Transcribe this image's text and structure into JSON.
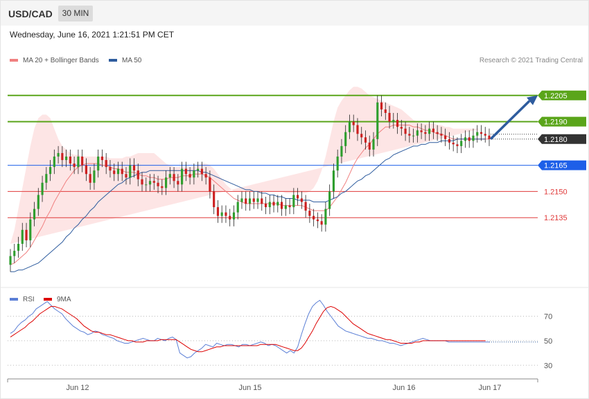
{
  "header": {
    "symbol": "USD/CAD",
    "timeframe": "30 MIN"
  },
  "timestamp": "Wednesday, June 16, 2021 1:21:51 PM CET",
  "copyright": "Research © 2021 Trading Central",
  "legend": {
    "price": [
      {
        "label": "MA 20 + Bollinger Bands",
        "color": "#f08080"
      },
      {
        "label": "MA 50",
        "color": "#2e5c9e"
      }
    ],
    "rsi": [
      {
        "label": "RSI",
        "color": "#5b7fd6"
      },
      {
        "label": "9MA",
        "color": "#dd0000"
      }
    ]
  },
  "colors": {
    "bullish": "#2e9e2e",
    "bearish": "#cc1f1f",
    "resistance": "#5aa51a",
    "support_strong": "#1d5fe8",
    "support": "#e03a3a",
    "arrow": "#2e5c9e",
    "band_fill": "#fde2e2"
  },
  "chart_data": [
    {
      "type": "line",
      "name": "price",
      "x_labels": [
        "Jun 12",
        "Jun 15",
        "Jun 16",
        "Jun 17"
      ],
      "ylim": [
        1.2095,
        1.222
      ],
      "last_price": "1.2180",
      "levels": [
        {
          "value": 1.2205,
          "label": "1.2205",
          "kind": "resistance"
        },
        {
          "value": 1.219,
          "label": "1.2190",
          "kind": "resistance"
        },
        {
          "value": 1.218,
          "label": "1.2180",
          "kind": "last"
        },
        {
          "value": 1.2165,
          "label": "1.2165",
          "kind": "support_strong"
        },
        {
          "value": 1.215,
          "label": "1.2150",
          "kind": "support"
        },
        {
          "value": 1.2135,
          "label": "1.2135",
          "kind": "support"
        }
      ],
      "close": [
        1.2113,
        1.2116,
        1.212,
        1.2128,
        1.2122,
        1.2134,
        1.214,
        1.2148,
        1.2155,
        1.216,
        1.2164,
        1.217,
        1.2172,
        1.2168,
        1.217,
        1.2166,
        1.2164,
        1.217,
        1.2165,
        1.216,
        1.2155,
        1.2162,
        1.217,
        1.2168,
        1.2164,
        1.2162,
        1.216,
        1.2163,
        1.216,
        1.2158,
        1.2165,
        1.2162,
        1.2157,
        1.2154,
        1.2154,
        1.2156,
        1.2155,
        1.2153,
        1.2152,
        1.2158,
        1.216,
        1.2156,
        1.2154,
        1.2163,
        1.216,
        1.2158,
        1.2162,
        1.2163,
        1.216,
        1.2158,
        1.215,
        1.2141,
        1.2136,
        1.2138,
        1.2136,
        1.2134,
        1.2138,
        1.2144,
        1.2146,
        1.2143,
        1.2146,
        1.2144,
        1.2146,
        1.2143,
        1.2141,
        1.2144,
        1.2142,
        1.2144,
        1.214,
        1.2142,
        1.2141,
        1.2148,
        1.2146,
        1.2144,
        1.2139,
        1.2136,
        1.2134,
        1.2133,
        1.2131,
        1.214,
        1.215,
        1.2162,
        1.217,
        1.2176,
        1.2184,
        1.219,
        1.2188,
        1.2183,
        1.2181,
        1.2178,
        1.2174,
        1.218,
        1.2201,
        1.2197,
        1.2195,
        1.219,
        1.2191,
        1.2187,
        1.2186,
        1.2183,
        1.2182,
        1.2182,
        1.2185,
        1.2184,
        1.2183,
        1.2186,
        1.2184,
        1.2183,
        1.2182,
        1.218,
        1.2178,
        1.2177,
        1.2176,
        1.2179,
        1.2181,
        1.2179,
        1.2182,
        1.2184,
        1.2183,
        1.2182,
        1.218
      ],
      "ma20": [
        1.2108,
        1.2109,
        1.2111,
        1.2113,
        1.2115,
        1.2118,
        1.2122,
        1.2126,
        1.213,
        1.2135,
        1.2139,
        1.2144,
        1.2148,
        1.2152,
        1.2156,
        1.2159,
        1.2162,
        1.2164,
        1.2165,
        1.2166,
        1.2166,
        1.2166,
        1.2166,
        1.2165,
        1.2165,
        1.2164,
        1.2163,
        1.2163,
        1.2162,
        1.2161,
        1.2161,
        1.2161,
        1.216,
        1.2159,
        1.2159,
        1.2158,
        1.2158,
        1.2157,
        1.2157,
        1.2157,
        1.2158,
        1.2158,
        1.2158,
        1.2159,
        1.2159,
        1.2159,
        1.216,
        1.216,
        1.216,
        1.2159,
        1.2158,
        1.2156,
        1.2154,
        1.2152,
        1.215,
        1.2148,
        1.2146,
        1.2145,
        1.2144,
        1.2143,
        1.2143,
        1.2143,
        1.2143,
        1.2143,
        1.2143,
        1.2143,
        1.2143,
        1.2143,
        1.2142,
        1.2142,
        1.2142,
        1.2142,
        1.2142,
        1.2142,
        1.2141,
        1.214,
        1.2139,
        1.2139,
        1.2139,
        1.2139,
        1.2141,
        1.2144,
        1.2147,
        1.2151,
        1.2155,
        1.216,
        1.2165,
        1.2169,
        1.2172,
        1.2175,
        1.2177,
        1.218,
        1.2183,
        1.2185,
        1.2187,
        1.2187,
        1.2188,
        1.2188,
        1.2188,
        1.2188,
        1.2188,
        1.2187,
        1.2187,
        1.2186,
        1.2185,
        1.2185,
        1.2184,
        1.2183,
        1.2183,
        1.2182,
        1.2181,
        1.218,
        1.218,
        1.218,
        1.218,
        1.218,
        1.218,
        1.218,
        1.218,
        1.218,
        1.218
      ],
      "ma50": [
        1.2104,
        1.2104,
        1.2105,
        1.2105,
        1.2106,
        1.2107,
        1.2108,
        1.2109,
        1.2111,
        1.2113,
        1.2115,
        1.2117,
        1.2119,
        1.2121,
        1.2124,
        1.2126,
        1.2129,
        1.2131,
        1.2134,
        1.2136,
        1.2139,
        1.2141,
        1.2144,
        1.2146,
        1.2148,
        1.215,
        1.2152,
        1.2154,
        1.2155,
        1.2157,
        1.2158,
        1.2159,
        1.216,
        1.2161,
        1.2161,
        1.2162,
        1.2162,
        1.2162,
        1.2162,
        1.2162,
        1.2162,
        1.2162,
        1.2162,
        1.2162,
        1.2162,
        1.2162,
        1.2162,
        1.2162,
        1.2161,
        1.2161,
        1.216,
        1.2159,
        1.2158,
        1.2157,
        1.2156,
        1.2155,
        1.2154,
        1.2153,
        1.2152,
        1.2151,
        1.2151,
        1.215,
        1.215,
        1.2149,
        1.2149,
        1.2148,
        1.2148,
        1.2147,
        1.2147,
        1.2146,
        1.2146,
        1.2146,
        1.2145,
        1.2145,
        1.2145,
        1.2145,
        1.2144,
        1.2144,
        1.2144,
        1.2144,
        1.2145,
        1.2146,
        1.2147,
        1.2149,
        1.215,
        1.2152,
        1.2154,
        1.2156,
        1.2157,
        1.2159,
        1.216,
        1.2162,
        1.2164,
        1.2166,
        1.2168,
        1.2169,
        1.2171,
        1.2172,
        1.2173,
        1.2174,
        1.2175,
        1.2176,
        1.2176,
        1.2177,
        1.2177,
        1.2178,
        1.2178,
        1.2178,
        1.2179,
        1.2179,
        1.2179,
        1.2179,
        1.218,
        1.218,
        1.218,
        1.218,
        1.218,
        1.218,
        1.218,
        1.218
      ],
      "bb_upper": [
        1.212,
        1.2128,
        1.214,
        1.2152,
        1.2164,
        1.2176,
        1.2186,
        1.2192,
        1.2194,
        1.2194,
        1.2192,
        1.2186,
        1.218,
        1.2176,
        1.2174,
        1.2172,
        1.2171,
        1.2171,
        1.217,
        1.217,
        1.217,
        1.217,
        1.217,
        1.217,
        1.217,
        1.2169,
        1.2169,
        1.2169,
        1.2169,
        1.217,
        1.217,
        1.2171,
        1.2172,
        1.2172,
        1.2172,
        1.2172,
        1.2172,
        1.217,
        1.2168,
        1.2166,
        1.2165,
        1.2164,
        1.2164,
        1.2164,
        1.2164,
        1.2164,
        1.2164,
        1.2165,
        1.2166,
        1.2166,
        1.2165,
        1.2163,
        1.216,
        1.2157,
        1.2154,
        1.2152,
        1.215,
        1.215,
        1.215,
        1.215,
        1.215,
        1.215,
        1.215,
        1.215,
        1.215,
        1.215,
        1.215,
        1.215,
        1.215,
        1.2149,
        1.2149,
        1.2149,
        1.2149,
        1.2149,
        1.2149,
        1.215,
        1.2152,
        1.2156,
        1.2162,
        1.217,
        1.218,
        1.219,
        1.2198,
        1.2202,
        1.2205,
        1.2208,
        1.221,
        1.221,
        1.2209,
        1.2207,
        1.2205,
        1.2204,
        1.2203,
        1.2202,
        1.2201,
        1.22,
        1.2199,
        1.2198,
        1.2197,
        1.2195,
        1.2193,
        1.2191,
        1.219,
        1.2189,
        1.2189,
        1.2189,
        1.2189,
        1.2188,
        1.2188,
        1.2187,
        1.2187,
        1.2186,
        1.2186,
        1.2186,
        1.2186,
        1.2186,
        1.2186,
        1.2186,
        1.2186
      ],
      "bb_lower": [
        1.2095,
        1.2094,
        1.2092,
        1.209,
        1.2087,
        1.2084,
        1.2082,
        1.2082,
        1.2084,
        1.2088,
        1.2094,
        1.2102,
        1.2112,
        1.2122,
        1.2132,
        1.214,
        1.2148,
        1.2153,
        1.2155,
        1.2156,
        1.2156,
        1.2156,
        1.2156,
        1.2156,
        1.2156,
        1.2155,
        1.2154,
        1.2154,
        1.2153,
        1.2152,
        1.2151,
        1.215,
        1.2149,
        1.2148,
        1.2147,
        1.2146,
        1.2145,
        1.2144,
        1.2144,
        1.2145,
        1.2146,
        1.2146,
        1.2146,
        1.2145,
        1.2145,
        1.2145,
        1.2146,
        1.2146,
        1.2145,
        1.2144,
        1.2142,
        1.214,
        1.2138,
        1.2137,
        1.2136,
        1.2135,
        1.2135,
        1.2136,
        1.2137,
        1.2137,
        1.2137,
        1.2137,
        1.2137,
        1.2137,
        1.2137,
        1.2137,
        1.2137,
        1.2136,
        1.2136,
        1.2135,
        1.2134,
        1.2133,
        1.2132,
        1.2132,
        1.2131,
        1.2128,
        1.2124,
        1.212,
        1.2118,
        1.2117,
        1.2118,
        1.2122,
        1.2128,
        1.2134,
        1.2142,
        1.215,
        1.2158,
        1.2164,
        1.2168,
        1.217,
        1.2172,
        1.2173,
        1.2174,
        1.2175,
        1.2175,
        1.2175,
        1.2175,
        1.2175,
        1.2175,
        1.2175,
        1.2175,
        1.2175,
        1.2175,
        1.2175,
        1.2175,
        1.2175,
        1.2175,
        1.2175,
        1.2175,
        1.2174,
        1.2174,
        1.2174,
        1.2174,
        1.2174,
        1.2174,
        1.2174,
        1.2174,
        1.2174,
        1.2174
      ]
    },
    {
      "type": "line",
      "name": "RSI",
      "ylim": [
        20,
        85
      ],
      "y_ticks": [
        70,
        50,
        30
      ],
      "rsi": [
        56,
        58,
        62,
        65,
        67,
        70,
        72,
        76,
        78,
        80,
        82,
        79,
        76,
        74,
        72,
        68,
        65,
        62,
        60,
        58,
        57,
        55,
        56,
        58,
        57,
        55,
        54,
        53,
        52,
        50,
        49,
        48,
        48,
        49,
        50,
        51,
        52,
        51,
        50,
        50,
        52,
        51,
        50,
        52,
        53,
        51,
        40,
        38,
        36,
        37,
        40,
        42,
        44,
        47,
        46,
        45,
        48,
        47,
        46,
        47,
        47,
        46,
        45,
        47,
        47,
        46,
        47,
        48,
        49,
        48,
        46,
        47,
        46,
        44,
        42,
        40,
        42,
        40,
        45,
        55,
        64,
        72,
        78,
        81,
        83,
        79,
        74,
        70,
        66,
        62,
        60,
        58,
        57,
        56,
        55,
        54,
        53,
        52,
        52,
        51,
        50,
        50,
        49,
        48,
        48,
        47,
        46,
        47,
        48,
        49,
        50,
        51,
        52,
        51,
        50,
        50,
        50,
        50,
        50,
        49,
        49,
        49,
        49,
        49,
        49,
        49,
        49,
        49,
        49,
        49,
        49
      ],
      "ma9": [
        53,
        55,
        57,
        59,
        61,
        64,
        66,
        69,
        72,
        74,
        76,
        78,
        78,
        77,
        76,
        74,
        72,
        70,
        68,
        65,
        62,
        60,
        58,
        57,
        57,
        56,
        55,
        55,
        54,
        53,
        52,
        51,
        50,
        50,
        49,
        49,
        49,
        50,
        50,
        50,
        50,
        51,
        51,
        51,
        51,
        51,
        49,
        47,
        45,
        43,
        42,
        41,
        41,
        42,
        43,
        44,
        45,
        45,
        46,
        46,
        46,
        46,
        46,
        46,
        46,
        46,
        46,
        46,
        47,
        47,
        47,
        47,
        47,
        46,
        45,
        44,
        43,
        42,
        42,
        44,
        48,
        53,
        58,
        64,
        69,
        74,
        77,
        78,
        77,
        75,
        73,
        70,
        67,
        64,
        62,
        60,
        58,
        56,
        55,
        54,
        53,
        52,
        51,
        51,
        50,
        49,
        48,
        48,
        48,
        48,
        49,
        49,
        50,
        50,
        50,
        50,
        50,
        50,
        50,
        50,
        50,
        50,
        50,
        50,
        50,
        50,
        50,
        50,
        50,
        50
      ]
    }
  ]
}
